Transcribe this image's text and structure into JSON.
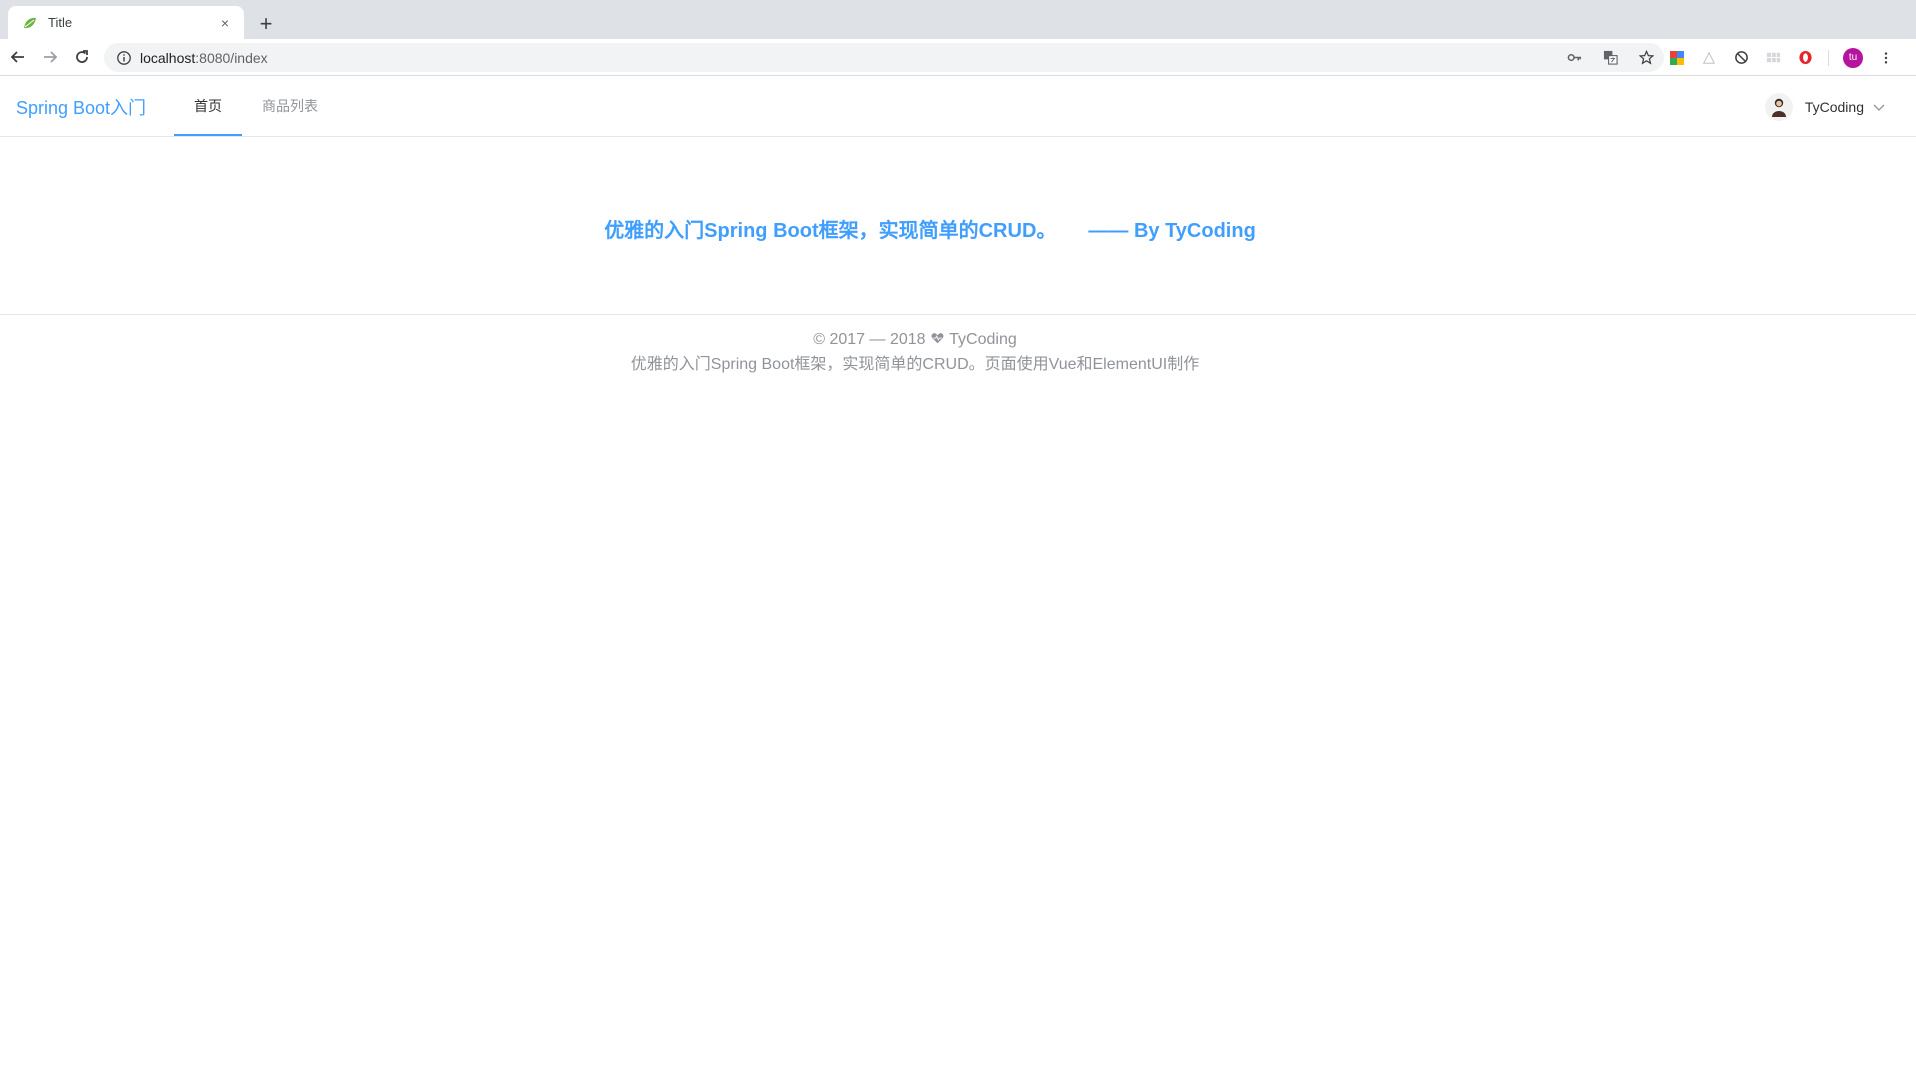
{
  "browser": {
    "tab_title": "Title",
    "tab_close": "×",
    "new_tab": "+",
    "url_host": "localhost",
    "url_path": ":8080/index",
    "profile_initials": "tu"
  },
  "header": {
    "brand": "Spring Boot入门",
    "menu": [
      {
        "label": "首页",
        "active": true
      },
      {
        "label": "商品列表",
        "active": false
      }
    ],
    "user_name": "TyCoding"
  },
  "main": {
    "headline": "优雅的入门Spring Boot框架，实现简单的CRUD。",
    "byline": "—— By TyCoding"
  },
  "footer": {
    "copyright_prefix": "© 2017 — 2018",
    "copyright_author": "TyCoding",
    "description": "优雅的入门Spring Boot框架，实现简单的CRUD。页面使用Vue和ElementUI制作"
  },
  "colors": {
    "accent": "#409eff",
    "muted_text": "#909399",
    "profile": "#b6139f"
  },
  "icons": {
    "favicon": "spring-leaf-icon",
    "back": "arrow-left-icon",
    "forward": "arrow-right-icon",
    "reload": "reload-icon",
    "site_info": "info-icon",
    "key": "key-icon",
    "translate": "translate-icon",
    "bookmark": "star-icon",
    "footer_heart": "heart-icon"
  }
}
